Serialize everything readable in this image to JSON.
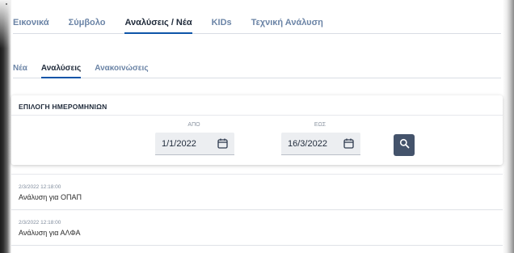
{
  "main_tabs": [
    {
      "label": "Εικονικά"
    },
    {
      "label": "Σύμβολο"
    },
    {
      "label": "Αναλύσεις / Νέα"
    },
    {
      "label": "KIDs"
    },
    {
      "label": "Τεχνική Ανάλυση"
    }
  ],
  "main_tab_active": "Αναλύσεις / Νέα",
  "sub_tabs": [
    {
      "label": "Νέα"
    },
    {
      "label": "Αναλύσεις"
    },
    {
      "label": "Ανακοινώσεις"
    }
  ],
  "sub_tab_active": "Αναλύσεις",
  "date_selection": {
    "title": "ΕΠΙΛΟΓΗ ΗΜΕΡΟΜΗΝΙΩΝ",
    "from_label": "ΑΠΟ",
    "from_value": "1/1/2022",
    "to_label": "ΕΩΣ",
    "to_value": "16/3/2022"
  },
  "results": [
    {
      "date": "2/3/2022 12:18:00",
      "title": "Ανάλυση για ΟΠΑΠ"
    },
    {
      "date": "2/3/2022 12:18:00",
      "title": "Ανάλυση για ΑΛΦΑ"
    }
  ],
  "colors": {
    "accent": "#0e55a8",
    "tab_inactive": "#6b84a6",
    "search_button": "#44536b"
  },
  "icons": {
    "calendar": "calendar-icon",
    "search": "search-icon"
  }
}
